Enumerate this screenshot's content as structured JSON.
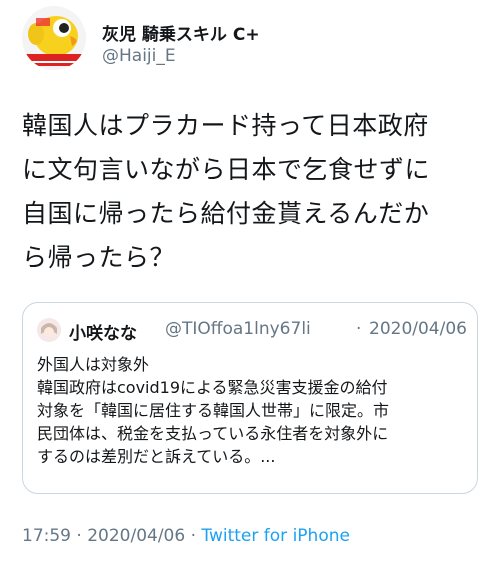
{
  "author": {
    "display_name": "灰児 騎乗スキル C+",
    "handle": "@Haiji_E",
    "avatar_icon": "yellow-bird-avatar-icon"
  },
  "tweet": {
    "lines": [
      "韓国人はプラカード持って日本政府",
      "に文句言いながら日本で乞食せずに",
      "自国に帰ったら給付金貰えるんだか",
      "ら帰ったら？"
    ]
  },
  "quote": {
    "display_name": "小咲なな",
    "handle": "@TIOffoa1lny67li",
    "separator": "·",
    "date": "2020/04/06",
    "avatar_icon": "anime-girl-avatar-icon",
    "lines": [
      "外国人は対象外",
      "韓国政府はcovid19による緊急災害支援金の給付",
      "対象を「韓国に居住する韓国人世帯」に限定。市",
      "民団体は、税金を支払っている永住者を対象外に",
      "するのは差別だと訴えている。..."
    ]
  },
  "footer": {
    "time_date": "17:59 · 2020/04/06 · ",
    "source": "Twitter for iPhone"
  },
  "colors": {
    "text": "#14171a",
    "secondary": "#657786",
    "link": "#1da1f2",
    "border": "#ccd6dd"
  }
}
